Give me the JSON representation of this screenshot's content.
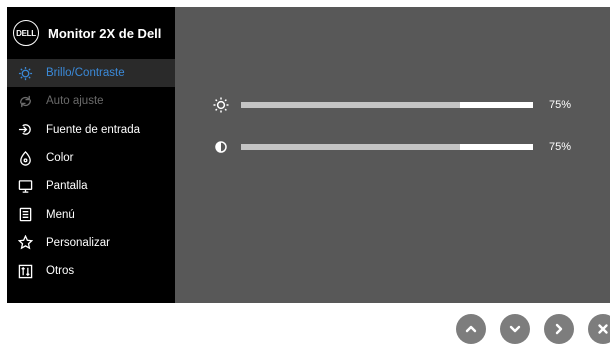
{
  "osd": {
    "brand_logo": "DELL",
    "title": "Monitor 2X de Dell",
    "menu": [
      {
        "label": "Brillo/Contraste",
        "icon": "brightness-icon",
        "state": "active"
      },
      {
        "label": "Auto ajuste",
        "icon": "auto-adjust-icon",
        "state": "disabled"
      },
      {
        "label": "Fuente de entrada",
        "icon": "input-source-icon",
        "state": "normal"
      },
      {
        "label": "Color",
        "icon": "color-icon",
        "state": "normal"
      },
      {
        "label": "Pantalla",
        "icon": "display-icon",
        "state": "normal"
      },
      {
        "label": "Menú",
        "icon": "menu-icon",
        "state": "normal"
      },
      {
        "label": "Personalizar",
        "icon": "star-icon",
        "state": "normal"
      },
      {
        "label": "Otros",
        "icon": "others-icon",
        "state": "normal"
      }
    ],
    "brightness": {
      "value_text": "75%",
      "level": 0.75,
      "icon": "sun-icon"
    },
    "contrast": {
      "value_text": "75%",
      "level": 0.75,
      "icon": "contrast-icon"
    }
  },
  "nav_buttons": [
    {
      "name": "up-button",
      "icon": "chevron-up-icon"
    },
    {
      "name": "down-button",
      "icon": "chevron-down-icon"
    },
    {
      "name": "right-button",
      "icon": "chevron-right-icon"
    },
    {
      "name": "exit-button",
      "icon": "close-icon"
    }
  ],
  "colors": {
    "sidebar_bg": "#000000",
    "panel_bg": "#585858",
    "accent": "#3b8ad9",
    "button_bg": "#7d7d7d"
  }
}
